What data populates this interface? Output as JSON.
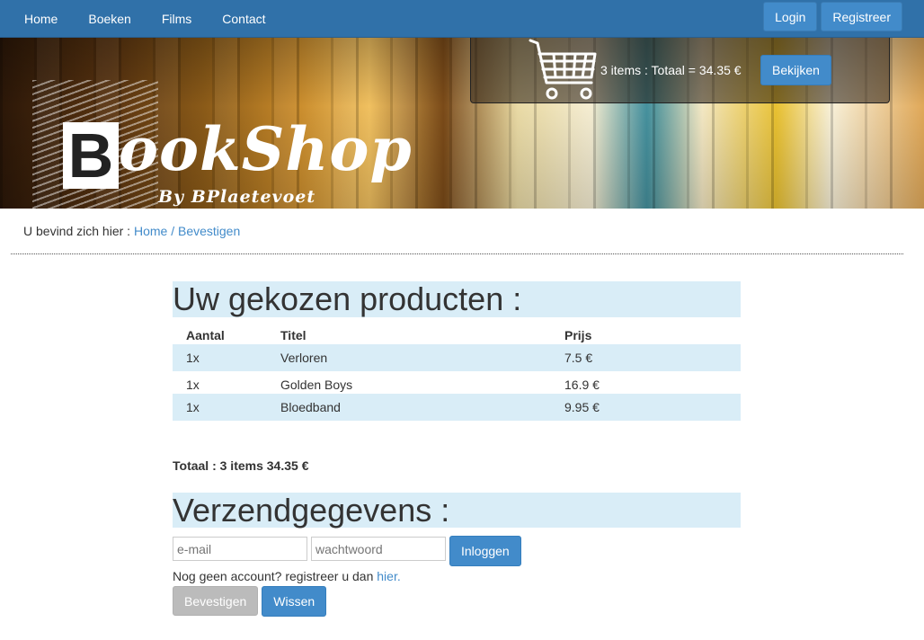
{
  "nav": {
    "links": [
      "Home",
      "Boeken",
      "Films",
      "Contact"
    ],
    "login_label": "Login",
    "register_label": "Registreer"
  },
  "logo": {
    "letter": "B",
    "rest": "ookShop",
    "subtitle": "By BPlaetevoet"
  },
  "cart": {
    "summary": "3 items : Totaal = 34.35 €",
    "view_label": "Bekijken"
  },
  "breadcrumb": {
    "prefix": "U bevind zich hier : ",
    "home": "Home",
    "separator": " / ",
    "current": "Bevestigen"
  },
  "products": {
    "title": "Uw gekozen producten :",
    "headers": [
      "Aantal",
      "Titel",
      "Prijs"
    ],
    "rows": [
      [
        "1x",
        "Verloren",
        "7.5 €"
      ],
      [
        "1x",
        "Golden Boys",
        "16.9 €"
      ],
      [
        "1x",
        "Bloedband",
        "9.95 €"
      ]
    ],
    "total": "Totaal : 3 items 34.35 €"
  },
  "shipping": {
    "title": "Verzendgegevens :",
    "email_placeholder": "e-mail",
    "password_placeholder": "wachtwoord",
    "login_label": "Inloggen",
    "register_text": "Nog geen account? registreer u dan ",
    "register_link": "hier.",
    "confirm_label": "Bevestigen",
    "clear_label": "Wissen"
  },
  "colors": {
    "navbar": "#3071a9",
    "primary": "#428bca",
    "highlight": "#d9edf7",
    "disabled": "#bbbbbb"
  }
}
